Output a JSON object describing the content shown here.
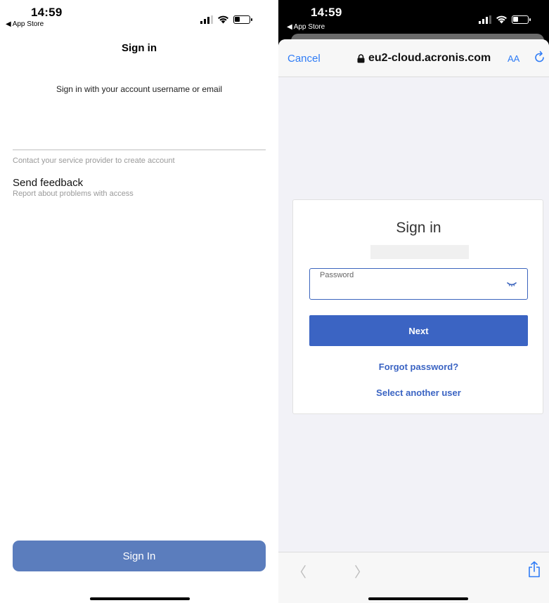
{
  "left": {
    "status": {
      "time": "14:59",
      "back_label": "App Store"
    },
    "title": "Sign in",
    "subtitle": "Sign in with your account username or email",
    "input": {
      "value": "",
      "placeholder": ""
    },
    "contact_text": "Contact your service provider to create account",
    "feedback": {
      "title": "Send feedback",
      "subtitle": "Report about problems with access"
    },
    "signin_button": "Sign In"
  },
  "right": {
    "status": {
      "time": "14:59",
      "back_label": "App Store"
    },
    "browser": {
      "cancel_label": "Cancel",
      "url": "eu2-cloud.acronis.com",
      "text_size_label": "AA",
      "lock_icon": "lock-icon",
      "reload_icon": "reload-icon"
    },
    "card": {
      "title": "Sign in",
      "password_label": "Password",
      "password_value": "",
      "eye_icon": "eye-closed-icon",
      "next_button": "Next",
      "forgot_link": "Forgot password?",
      "select_user_link": "Select another user"
    },
    "toolbar": {
      "back_icon": "chevron-left-icon",
      "forward_icon": "chevron-right-icon",
      "share_icon": "share-icon"
    }
  },
  "colors": {
    "ios_blue": "#2f7cf6",
    "acronis_blue": "#3b64c3",
    "signin_button_bg": "#5b7dbd",
    "secondary_text": "#9a9a9a"
  }
}
